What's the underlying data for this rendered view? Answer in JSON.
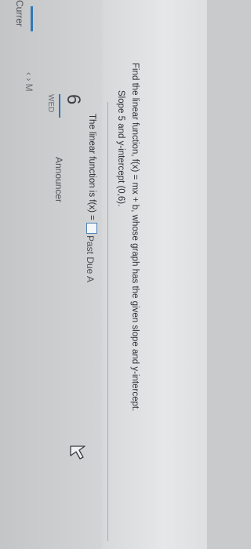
{
  "sidebar": {
    "current_label": "Currer",
    "nav_arrows": "‹ › M",
    "wed_label": "WED",
    "day_number": "6",
    "announcements_label": "Announcer",
    "past_due_label": "Past Due A"
  },
  "question": {
    "prompt": "Find the linear function, f(x) = mx + b, whose graph has the given slope and y-intercept.",
    "given": "Slope 5 and y-intercept (0,6).",
    "answer_prefix": "The linear function is f(x) =",
    "answer_value": "",
    "answer_suffix": "."
  },
  "colors": {
    "accent": "#2f78b7",
    "background": "#d8d9db"
  },
  "icons": {
    "cursor": "arrow-cursor-icon"
  }
}
